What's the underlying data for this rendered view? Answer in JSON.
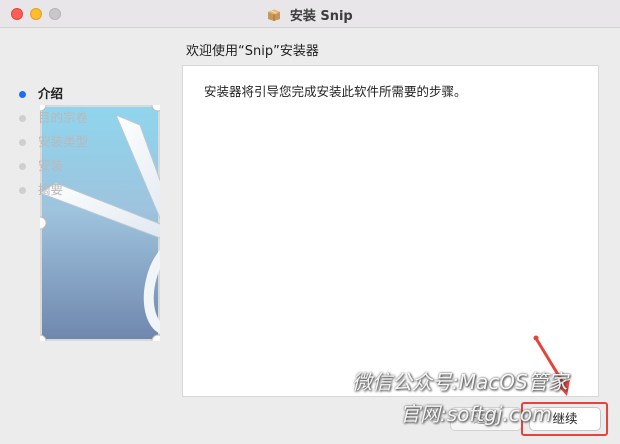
{
  "window": {
    "title": "安装 Snip"
  },
  "content": {
    "heading": "欢迎使用“Snip”安装器",
    "body_text": "安装器将引导您完成安装此软件所需要的步骤。"
  },
  "steps": [
    {
      "label": "介绍",
      "state": "active"
    },
    {
      "label": "目的宗卷",
      "state": "inactive"
    },
    {
      "label": "安装类型",
      "state": "inactive"
    },
    {
      "label": "安装",
      "state": "inactive"
    },
    {
      "label": "摘要",
      "state": "inactive"
    }
  ],
  "buttons": {
    "back_label": "返回",
    "continue_label": "继续"
  },
  "watermark": {
    "line1": "微信公众号:MacOS管家",
    "line2": "官网:softgj.com"
  },
  "colors": {
    "accent": "#1a6ff5",
    "annotation": "#e5443c",
    "close": "#fe5f57",
    "minimize": "#febc2e",
    "maximize_disabled": "#c9c7c9"
  },
  "icons": {
    "title_icon": "package-icon",
    "side_art": "scissors-icon"
  }
}
